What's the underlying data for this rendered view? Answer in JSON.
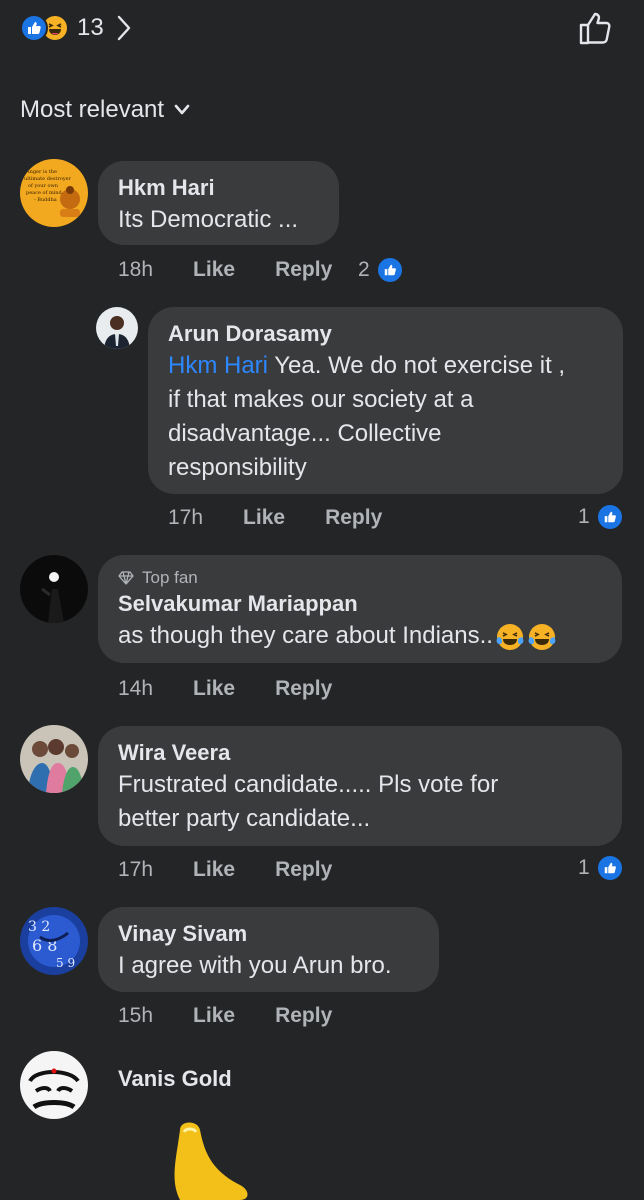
{
  "header": {
    "reaction_count": "13",
    "sort_label": "Most relevant"
  },
  "comments": [
    {
      "name": "Hkm Hari",
      "text": "Its Democratic ...",
      "time": "18h",
      "like": "Like",
      "reply": "Reply",
      "likes": "2",
      "avatar_text": [
        "Anger is the",
        "ultimate destroyer",
        "of your own",
        "peace of mind",
        "- Buddha"
      ]
    },
    {
      "name": "Arun Dorasamy",
      "mention": "Hkm Hari",
      "text_lines": [
        " Yea. We do not exercise it ,",
        "if that makes our society at a",
        "disadvantage... Collective",
        "responsibility"
      ],
      "time": "17h",
      "like": "Like",
      "reply": "Reply",
      "likes": "1"
    },
    {
      "badge": "Top fan",
      "name": "Selvakumar Mariappan",
      "text": "as though they care about Indians..",
      "time": "14h",
      "like": "Like",
      "reply": "Reply"
    },
    {
      "name": "Wira Veera",
      "text_lines": [
        "Frustrated candidate..... Pls vote for",
        "better party candidate..."
      ],
      "time": "17h",
      "like": "Like",
      "reply": "Reply",
      "likes": "1"
    },
    {
      "name": "Vinay Sivam",
      "text": "I agree with you Arun bro.",
      "time": "15h",
      "like": "Like",
      "reply": "Reply"
    },
    {
      "name": "Vanis Gold"
    }
  ],
  "colors": {
    "background": "#242526",
    "bubble": "#3a3b3c",
    "accent": "#1b74e4",
    "mention": "#2d88ff"
  },
  "icons": [
    "like-reaction-icon",
    "haha-reaction-icon",
    "chevron-right-icon",
    "thumbs-up-outline-icon",
    "chevron-down-icon",
    "diamond-icon",
    "laughing-tears-emoji-icon"
  ]
}
